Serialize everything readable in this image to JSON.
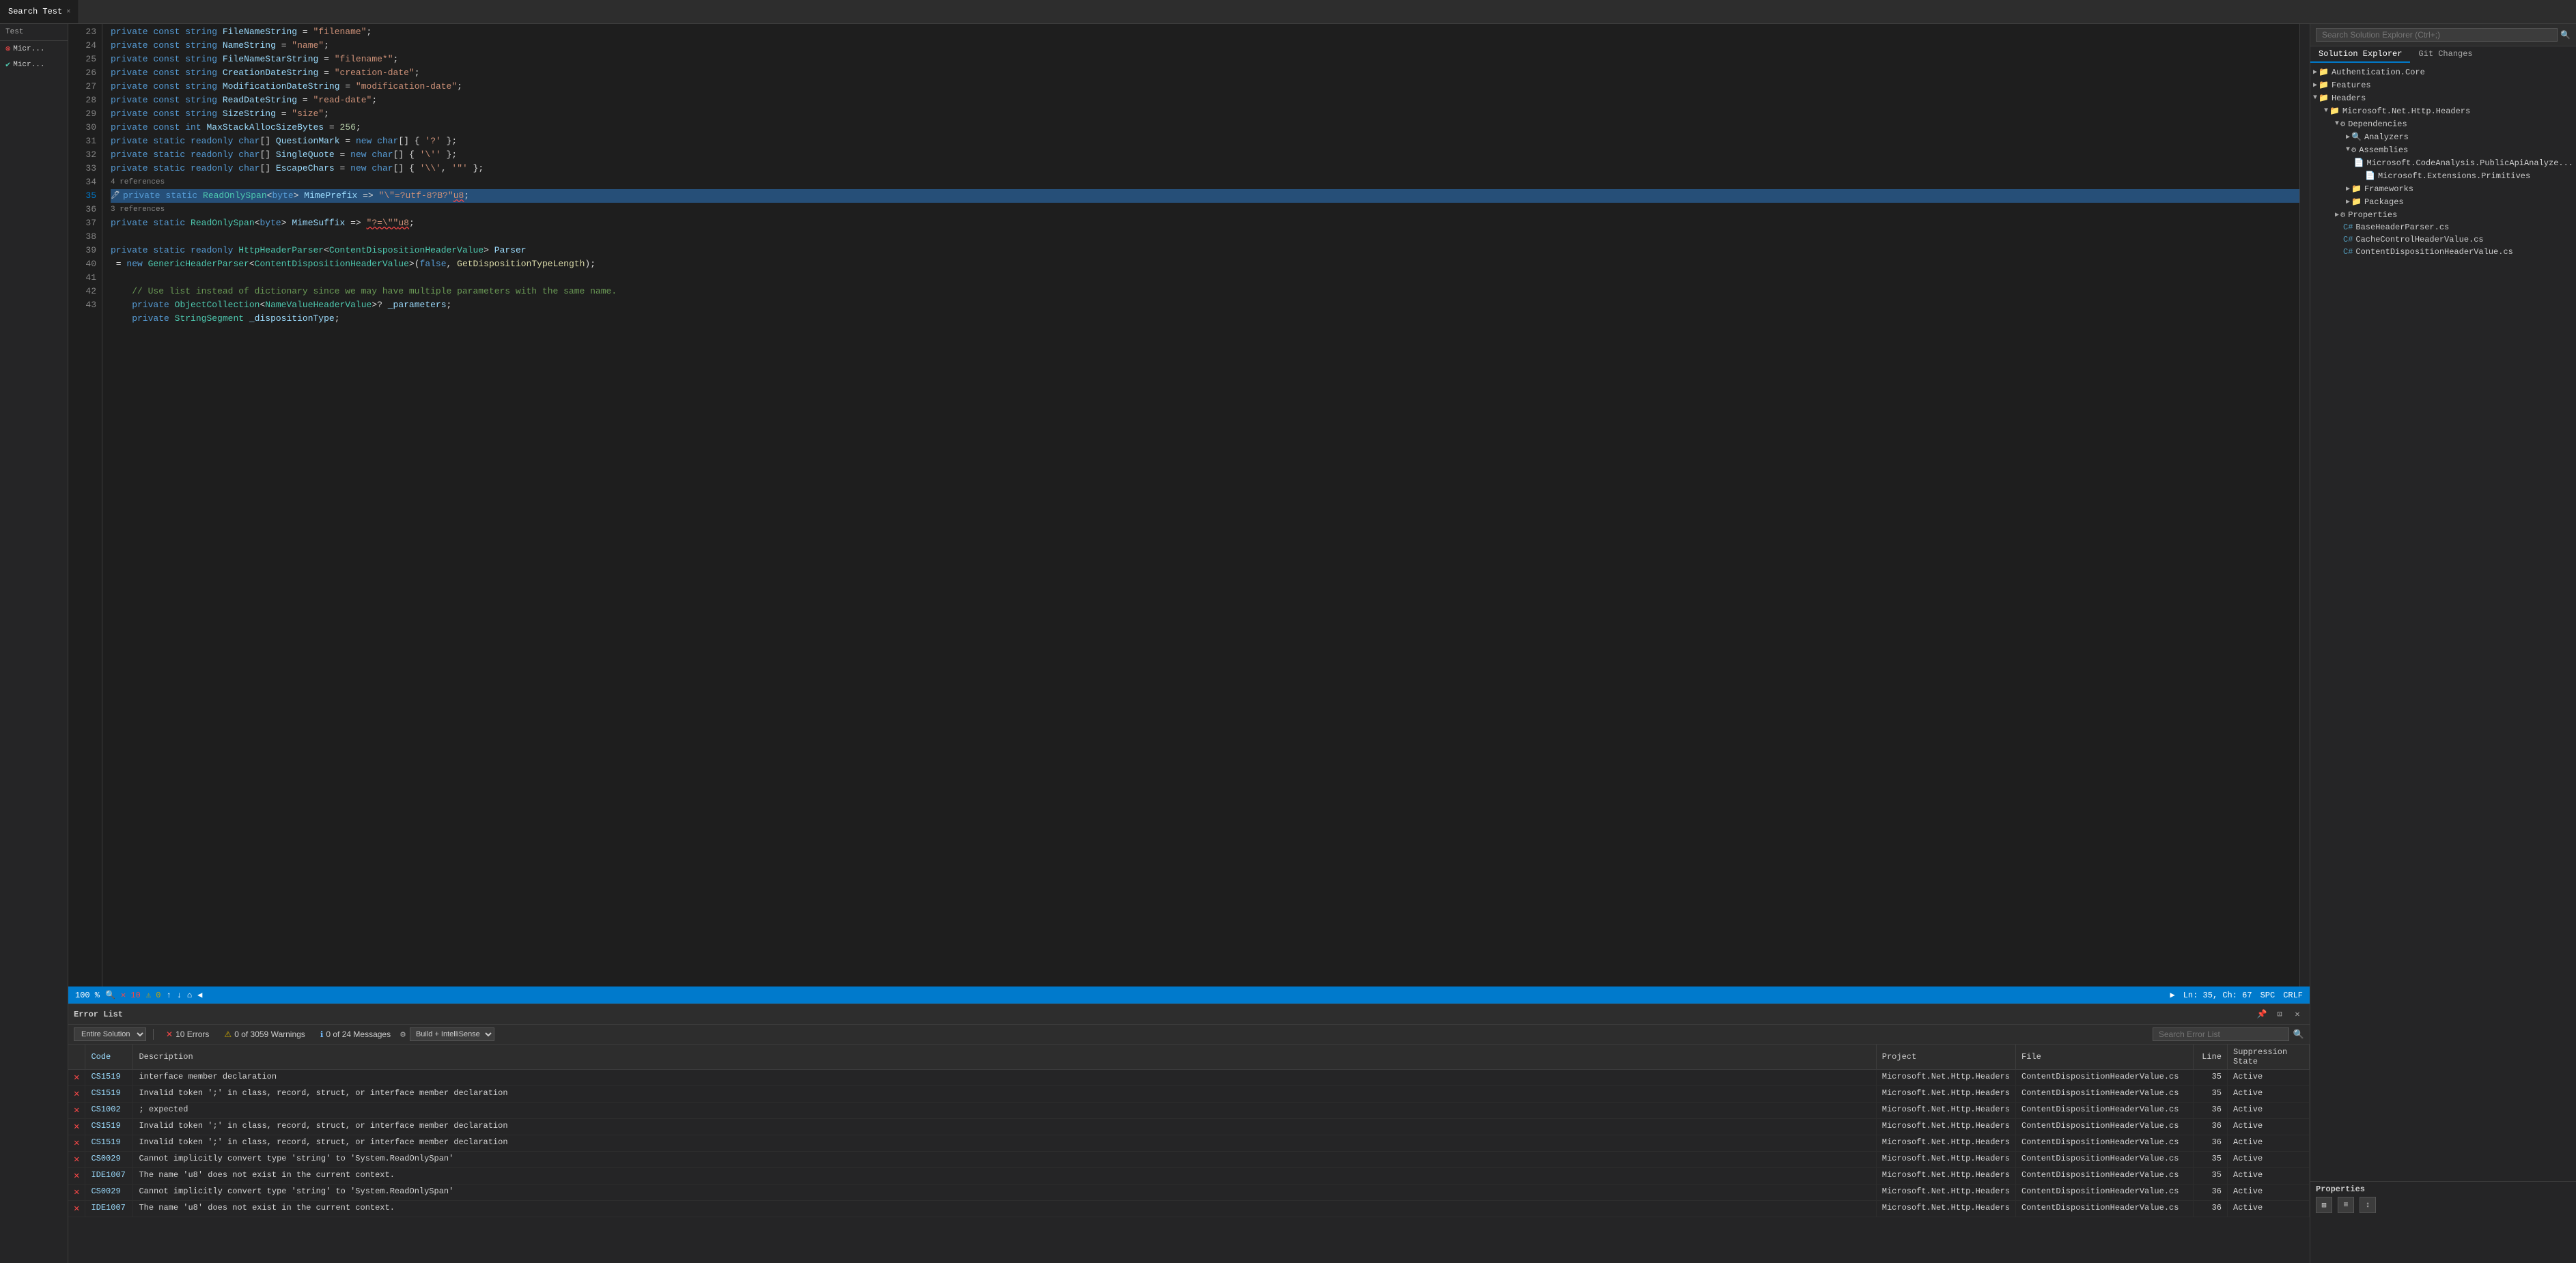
{
  "tabs": [
    {
      "label": "Search Test",
      "active": true
    }
  ],
  "left_sidebar": {
    "title": "Test",
    "items": [
      {
        "icon": "x-circle",
        "label": "Micr...",
        "status": "error"
      },
      {
        "icon": "check-circle",
        "label": "Micr...",
        "status": "success"
      }
    ]
  },
  "editor": {
    "filename": "ContentDispositionHeaderValue.cs",
    "zoom": "100 %",
    "errors": "10",
    "warnings": "0",
    "ln": "35",
    "ch": "67",
    "encoding": "SPC",
    "line_ending": "CRLF",
    "lines": [
      {
        "num": 24,
        "content": "    private const string FileNameString = \"filename\";"
      },
      {
        "num": 25,
        "content": "    private const string NameString = \"name\";"
      },
      {
        "num": 26,
        "content": "    private const string FileNameStarString = \"filename*\";"
      },
      {
        "num": 27,
        "content": "    private const string CreationDateString = \"creation-date\";"
      },
      {
        "num": 28,
        "content": "    private const string ModificationDateString = \"modification-date\";"
      },
      {
        "num": 29,
        "content": "    private const string ReadDateString = \"read-date\";"
      },
      {
        "num": 30,
        "content": "    private const string SizeString = \"size\";"
      },
      {
        "num": 31,
        "content": "    private const int MaxStackAllocSizeBytes = 256;"
      },
      {
        "num": 32,
        "content": "    private static readonly char[] QuestionMark = new char[] { '?' };"
      },
      {
        "num": 33,
        "content": "    private static readonly char[] SingleQuote = new char[] { '\\'' };"
      },
      {
        "num": 34,
        "content": "    private static readonly char[] EscapeChars = new char[] { '\\\\', '\"' };"
      },
      {
        "num": 35,
        "ref_count": "4 references",
        "content": "    private static ReadOnlySpan<byte> MimePrefix => \"\\\"=?utf-8?B?\"u8;",
        "highlighted": true
      },
      {
        "num": 36,
        "ref_count": "3 references",
        "content": "    private static ReadOnlySpan<byte> MimeSuffix => \"?=\\\"\"u8;"
      },
      {
        "num": 37,
        "content": ""
      },
      {
        "num": 38,
        "content": "    private static readonly HttpHeaderParser<ContentDispositionHeaderValue> Parser"
      },
      {
        "num": 39,
        "content": "        = new GenericHeaderParser<ContentDispositionHeaderValue>(false, GetDispositionTypeLength);"
      },
      {
        "num": 40,
        "content": ""
      },
      {
        "num": 41,
        "content": "    // Use list instead of dictionary since we may have multiple parameters with the same name."
      },
      {
        "num": 42,
        "content": "    private ObjectCollection<NameValueHeaderValue>? _parameters;"
      },
      {
        "num": 43,
        "content": "    private StringSegment _dispositionType;"
      }
    ]
  },
  "error_list": {
    "title": "Error List",
    "scope": "Entire Solution",
    "filter": "Build + IntelliSense",
    "search_placeholder": "Search Error List",
    "error_count": "10 Errors",
    "warning_count": "0 of 3059 Warnings",
    "message_count": "0 of 24 Messages",
    "columns": [
      "",
      "Code",
      "Description",
      "Project",
      "File",
      "Line",
      "Suppression State"
    ],
    "rows": [
      {
        "code": "CS1519",
        "description": "interface member declaration",
        "project": "Microsoft.Net.Http.Headers",
        "file": "ContentDispositionHeaderValue.cs",
        "line": "35",
        "state": "Active"
      },
      {
        "code": "CS1519",
        "description": "Invalid token ';' in class, record, struct, or interface member declaration",
        "project": "Microsoft.Net.Http.Headers",
        "file": "ContentDispositionHeaderValue.cs",
        "line": "35",
        "state": "Active"
      },
      {
        "code": "CS1002",
        "description": "; expected",
        "project": "Microsoft.Net.Http.Headers",
        "file": "ContentDispositionHeaderValue.cs",
        "line": "36",
        "state": "Active"
      },
      {
        "code": "CS1519",
        "description": "Invalid token ';' in class, record, struct, or interface member declaration",
        "project": "Microsoft.Net.Http.Headers",
        "file": "ContentDispositionHeaderValue.cs",
        "line": "36",
        "state": "Active"
      },
      {
        "code": "CS1519",
        "description": "Invalid token ';' in class, record, struct, or interface member declaration",
        "project": "Microsoft.Net.Http.Headers",
        "file": "ContentDispositionHeaderValue.cs",
        "line": "36",
        "state": "Active"
      },
      {
        "code": "CS0029",
        "description": "Cannot implicitly convert type 'string' to 'System.ReadOnlySpan<byte>'",
        "project": "Microsoft.Net.Http.Headers",
        "file": "ContentDispositionHeaderValue.cs",
        "line": "35",
        "state": "Active"
      },
      {
        "code": "IDE1007",
        "description": "The name 'u8' does not exist in the current context.",
        "project": "Microsoft.Net.Http.Headers",
        "file": "ContentDispositionHeaderValue.cs",
        "line": "35",
        "state": "Active"
      },
      {
        "code": "CS0029",
        "description": "Cannot implicitly convert type 'string' to 'System.ReadOnlySpan<byte>'",
        "project": "Microsoft.Net.Http.Headers",
        "file": "ContentDispositionHeaderValue.cs",
        "line": "36",
        "state": "Active"
      },
      {
        "code": "IDE1007",
        "description": "The name 'u8' does not exist in the current context.",
        "project": "Microsoft.Net.Http.Headers",
        "file": "ContentDispositionHeaderValue.cs",
        "line": "36",
        "state": "Active"
      }
    ]
  },
  "solution_explorer": {
    "search_placeholder": "Search Solution Explorer (Ctrl+;)",
    "tabs": [
      "Solution Explorer",
      "Git Changes"
    ],
    "active_tab": "Solution Explorer",
    "tree": [
      {
        "level": 0,
        "arrow": "▶",
        "icon": "folder",
        "label": "Authentication.Core"
      },
      {
        "level": 0,
        "arrow": "▶",
        "icon": "folder",
        "label": "Features"
      },
      {
        "level": 0,
        "arrow": "▼",
        "icon": "folder",
        "label": "Headers",
        "expanded": true
      },
      {
        "level": 1,
        "arrow": "▼",
        "icon": "folder",
        "label": "Microsoft.Net.Http.Headers",
        "expanded": true
      },
      {
        "level": 2,
        "arrow": "▼",
        "icon": "dependencies",
        "label": "Dependencies",
        "expanded": true
      },
      {
        "level": 3,
        "arrow": "▶",
        "icon": "analyzer",
        "label": "Analyzers"
      },
      {
        "level": 3,
        "arrow": "▼",
        "icon": "assemblies",
        "label": "Assemblies",
        "expanded": true
      },
      {
        "level": 4,
        "arrow": "",
        "icon": "file",
        "label": "Microsoft.CodeAnalysis.PublicApiAnalyze..."
      },
      {
        "level": 4,
        "arrow": "",
        "icon": "file",
        "label": "Microsoft.Extensions.Primitives"
      },
      {
        "level": 3,
        "arrow": "▶",
        "icon": "folder",
        "label": "Frameworks"
      },
      {
        "level": 3,
        "arrow": "▶",
        "icon": "folder",
        "label": "Packages"
      },
      {
        "level": 2,
        "arrow": "▶",
        "icon": "properties",
        "label": "Properties"
      },
      {
        "level": 2,
        "arrow": "",
        "icon": "cs-file",
        "label": "BaseHeaderParser.cs"
      },
      {
        "level": 2,
        "arrow": "",
        "icon": "cs-file",
        "label": "CacheControlHeaderValue.cs"
      },
      {
        "level": 2,
        "arrow": "",
        "icon": "cs-file",
        "label": "ContentDispositionHeaderValue.cs"
      }
    ]
  },
  "properties_panel": {
    "title": "Properties",
    "buttons": [
      "grid-view",
      "category-view",
      "sort"
    ]
  }
}
